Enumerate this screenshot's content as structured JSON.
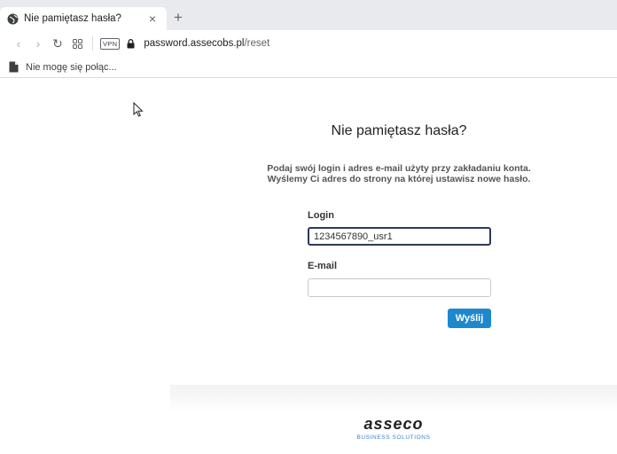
{
  "browser": {
    "tab": {
      "title": "Nie pamiętasz hasła?",
      "close": "×",
      "favicon": "globe-icon"
    },
    "new_tab": "+",
    "nav": {
      "back": "‹",
      "forward": "›",
      "reload": "↻",
      "speed_dial": "grid-icon"
    },
    "vpn_badge": "VPN",
    "address": {
      "host": "password.assecobs.pl",
      "path": "/reset"
    },
    "bookmark": {
      "label": "Nie mogę się połąc...",
      "icon": "page-icon"
    }
  },
  "page": {
    "title": "Nie pamiętasz hasła?",
    "instructions_line1": "Podaj swój login i adres e-mail użyty przy zakładaniu konta.",
    "instructions_line2": "Wyślemy Ci adres do strony na której ustawisz nowe hasło.",
    "login_label": "Login",
    "login_value": "1234567890_usr1",
    "email_label": "E-mail",
    "email_value": "",
    "submit_label": "Wyślij",
    "logo_text": "asseco",
    "logo_subtitle": "BUSINESS SOLUTIONS"
  },
  "colors": {
    "accent": "#1e88cf",
    "focus_border": "#2b3a55",
    "tab_strip": "#e8eaed"
  }
}
